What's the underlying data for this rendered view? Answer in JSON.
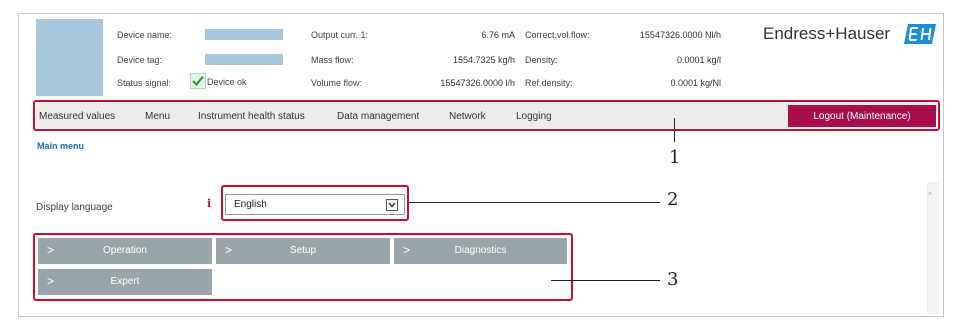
{
  "header": {
    "device_name_label": "Device name:",
    "device_tag_label": "Device tag:",
    "status_signal_label": "Status signal:",
    "status_value": "Device ok",
    "output_curr_label": "Output curr. 1:",
    "output_curr_value": "6.76 mA",
    "mass_flow_label": "Mass flow:",
    "mass_flow_value": "1554.7325 kg/h",
    "volume_flow_label": "Volume flow:",
    "volume_flow_value": "15547326.0000 l/h",
    "corr_vol_flow_label": "Correct.vol.flow:",
    "corr_vol_flow_value": "15547326.0000 Nl/h",
    "density_label": "Density:",
    "density_value": "0.0001 kg/l",
    "ref_density_label": "Ref.density:",
    "ref_density_value": "0.0001 kg/Nl"
  },
  "logo": {
    "brand": "Endress+Hauser",
    "badge": "EH",
    "color": "#1a8fd6"
  },
  "nav": {
    "items": [
      "Measured values",
      "Menu",
      "Instrument health status",
      "Data management",
      "Network",
      "Logging"
    ],
    "logout_label": "Logout (Maintenance)"
  },
  "main_menu_link": "Main menu",
  "display_language": {
    "label": "Display language",
    "info_icon": "i",
    "value": "English"
  },
  "tiles": [
    "Operation",
    "Setup",
    "Diagnostics",
    "Expert"
  ],
  "callouts": [
    "1",
    "2",
    "3"
  ],
  "colors": {
    "highlight": "#c8102e",
    "logout": "#a50e4a",
    "tile": "#9aa5a9",
    "field": "#a9c7dc",
    "link": "#1a6fa8"
  }
}
